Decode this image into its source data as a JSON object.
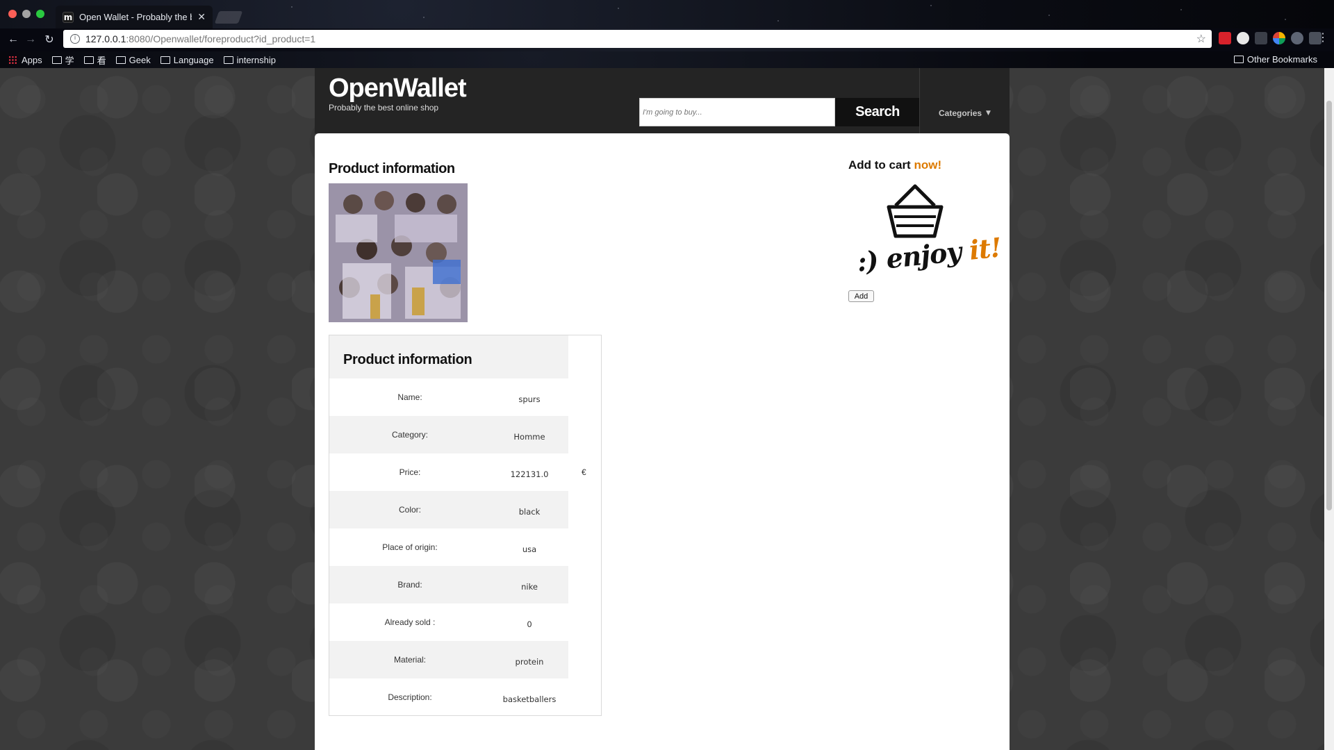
{
  "browser": {
    "tab_title": "Open Wallet - Probably the be",
    "tab_favicon": "m",
    "url_host": "127.0.0.1",
    "url_rest": ":8080/Openwallet/foreproduct?id_product=1",
    "bookmarks": [
      "Apps",
      "学",
      "看",
      "Geek",
      "Language",
      "internship"
    ],
    "other_bookmarks": "Other Bookmarks"
  },
  "header": {
    "logo": "OpenWallet",
    "tagline": "Probably the best online shop",
    "search_placeholder": "I'm going to buy...",
    "search_button": "Search",
    "categories": "Categories"
  },
  "product": {
    "heading": "Product information",
    "table_heading": "Product information",
    "rows": [
      {
        "label": "Name:",
        "value": "spurs"
      },
      {
        "label": "Category:",
        "value": "Homme"
      },
      {
        "label": "Price:",
        "value": "122131.0"
      },
      {
        "label": "Color:",
        "value": "black"
      },
      {
        "label": "Place of origin:",
        "value": "usa"
      },
      {
        "label": "Brand:",
        "value": "nike"
      },
      {
        "label": "Already sold :",
        "value": "0"
      },
      {
        "label": "Material:",
        "value": "protein"
      },
      {
        "label": "Description:",
        "value": "basketballers"
      }
    ],
    "currency": "€"
  },
  "cart": {
    "title_prefix": "Add to cart ",
    "title_highlight": "now!",
    "enjoy_prefix": ":) enjoy ",
    "enjoy_highlight": "it!",
    "add_button": "Add"
  },
  "colors": {
    "accent": "#dd7a00",
    "header_bg": "#242424"
  }
}
